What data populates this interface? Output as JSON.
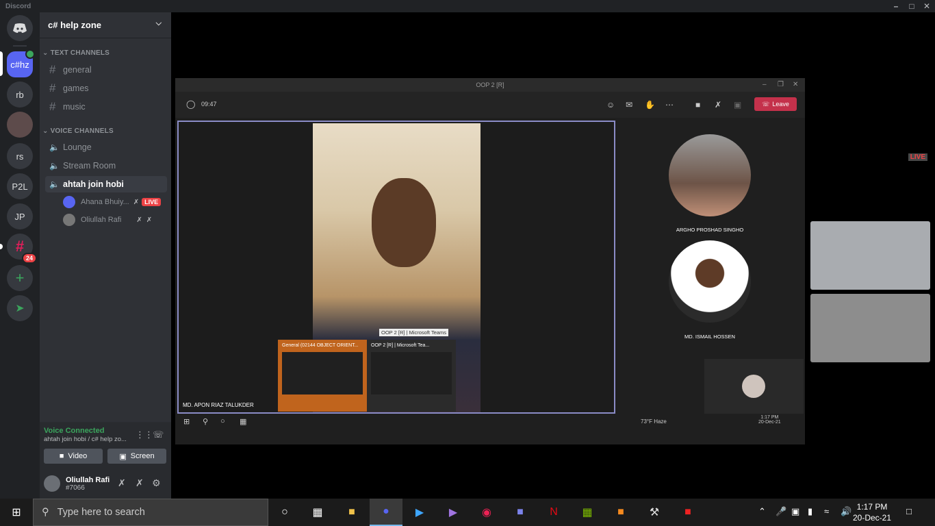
{
  "window": {
    "app_name": "Discord"
  },
  "guilds": {
    "items": [
      {
        "label": "c#hz"
      },
      {
        "label": "rb"
      },
      {
        "label": "rs"
      },
      {
        "label": "P2L"
      },
      {
        "label": "JP"
      }
    ],
    "mention_count": "24"
  },
  "server": {
    "name": "c# help zone",
    "text_category": "TEXT CHANNELS",
    "text_channels": [
      "general",
      "games",
      "music"
    ],
    "voice_category": "VOICE CHANNELS",
    "voice_channels": [
      "Lounge",
      "Stream Room",
      "ahtah join hobi"
    ],
    "voice_users": [
      {
        "name": "Ahana Bhuiy...",
        "badge": "LIVE"
      },
      {
        "name": "Oliullah Rafi"
      }
    ]
  },
  "voice_panel": {
    "status": "Voice Connected",
    "location": "ahtah join hobi / c# help zo...",
    "video_label": "Video",
    "screen_label": "Screen"
  },
  "user_panel": {
    "name": "Oliullah Rafi",
    "tag": "#7066"
  },
  "stream": {
    "teams_window_title": "OOP 2 [R]",
    "call_timer": "09:47",
    "leave_label": "Leave",
    "main_speaker": "MD. APON RIAZ TALUKDER",
    "participants": [
      "ARGHO PROSHAD SINGHO",
      "MD. ISMAIL HOSSEN"
    ],
    "preview_tooltip": "OOP 2 [R] | Microsoft Teams",
    "preview_windows": [
      "General (02144 OBJECT ORIENT...",
      "OOP 2 [R] | Microsoft Tea..."
    ],
    "weather": "73°F  Haze",
    "inner_time": "1:17 PM",
    "inner_date": "20-Dec-21"
  },
  "cast_live_badge": "LIVE",
  "taskbar": {
    "search_placeholder": "Type here to search",
    "time": "1:17 PM",
    "date": "20-Dec-21"
  },
  "colors": {
    "blurple": "#5865f2",
    "green": "#3ba55d",
    "red": "#ed4245",
    "teams_leave": "#c4314b"
  }
}
